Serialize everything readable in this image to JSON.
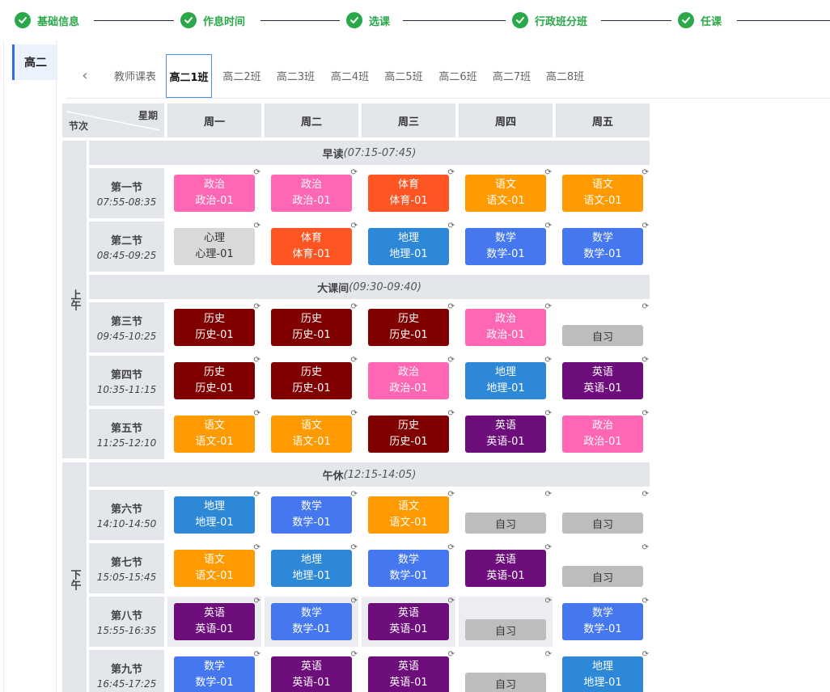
{
  "steps": [
    "基础信息",
    "作息时间",
    "选课",
    "行政班分班",
    "任课"
  ],
  "sidebar": {
    "items": [
      {
        "label": "高二"
      }
    ]
  },
  "tabs": [
    "教师课表",
    "高二1班",
    "高二2班",
    "高二3班",
    "高二4班",
    "高二5班",
    "高二6班",
    "高二7班",
    "高二8班"
  ],
  "active_tab": "高二1班",
  "table": {
    "corner_top": "星期",
    "corner_bottom": "节次",
    "days": [
      "周一",
      "周二",
      "周三",
      "周四",
      "周五"
    ],
    "am_label": "上午",
    "pm_label": "下午",
    "self_study_label": "自习",
    "breaks": [
      {
        "name": "早读",
        "time": "(07:15-07:45)"
      },
      {
        "name": "大课间",
        "time": "(09:30-09:40)"
      },
      {
        "name": "午休",
        "time": "(12:15-14:05)"
      }
    ],
    "periods": [
      {
        "name": "第一节",
        "time": "07:55-08:35",
        "slots": [
          [
            "政治",
            "政治-01"
          ],
          [
            "政治",
            "政治-01"
          ],
          [
            "体育",
            "体育-01"
          ],
          [
            "语文",
            "语文-01"
          ],
          [
            "语文",
            "语文-01"
          ]
        ]
      },
      {
        "name": "第二节",
        "time": "08:45-09:25",
        "slots": [
          [
            "心理",
            "心理-01"
          ],
          [
            "体育",
            "体育-01"
          ],
          [
            "地理",
            "地理-01"
          ],
          [
            "数学",
            "数学-01"
          ],
          [
            "数学",
            "数学-01"
          ]
        ]
      },
      {
        "name": "第三节",
        "time": "09:45-10:25",
        "slots": [
          [
            "历史",
            "历史-01"
          ],
          [
            "历史",
            "历史-01"
          ],
          [
            "历史",
            "历史-01"
          ],
          [
            "政治",
            "政治-01"
          ],
          null
        ]
      },
      {
        "name": "第四节",
        "time": "10:35-11:15",
        "slots": [
          [
            "历史",
            "历史-01"
          ],
          [
            "历史",
            "历史-01"
          ],
          [
            "政治",
            "政治-01"
          ],
          [
            "地理",
            "地理-01"
          ],
          [
            "英语",
            "英语-01"
          ]
        ]
      },
      {
        "name": "第五节",
        "time": "11:25-12:10",
        "slots": [
          [
            "语文",
            "语文-01"
          ],
          [
            "语文",
            "语文-01"
          ],
          [
            "历史",
            "历史-01"
          ],
          [
            "英语",
            "英语-01"
          ],
          [
            "政治",
            "政治-01"
          ]
        ]
      },
      {
        "name": "第六节",
        "time": "14:10-14:50",
        "slots": [
          [
            "地理",
            "地理-01"
          ],
          [
            "数学",
            "数学-01"
          ],
          [
            "语文",
            "语文-01"
          ],
          null,
          null
        ]
      },
      {
        "name": "第七节",
        "time": "15:05-15:45",
        "slots": [
          [
            "语文",
            "语文-01"
          ],
          [
            "地理",
            "地理-01"
          ],
          [
            "数学",
            "数学-01"
          ],
          [
            "英语",
            "英语-01"
          ],
          null
        ]
      },
      {
        "name": "第八节",
        "time": "15:55-16:35",
        "slots": [
          [
            "英语",
            "英语-01"
          ],
          [
            "数学",
            "数学-01"
          ],
          [
            "英语",
            "英语-01"
          ],
          null,
          [
            "数学",
            "数学-01"
          ]
        ]
      },
      {
        "name": "第九节",
        "time": "16:45-17:25",
        "slots": [
          [
            "数学",
            "数学-01"
          ],
          [
            "英语",
            "英语-01"
          ],
          [
            "英语",
            "英语-01"
          ],
          null,
          [
            "地理",
            "地理-01"
          ]
        ]
      }
    ]
  },
  "subject_colors": {
    "政治": "#ff66b3",
    "体育": "#ff5522",
    "语文": "#ff9a00",
    "心理": "#d9d9d9",
    "地理": "#2e88d8",
    "数学": "#4477f0",
    "历史": "#800000",
    "英语": "#6e0e7d"
  },
  "colors": {
    "step_done": "#2aa84a",
    "tab_active_border": "#4a90e2",
    "sidebar_active": "#2f6fde"
  }
}
